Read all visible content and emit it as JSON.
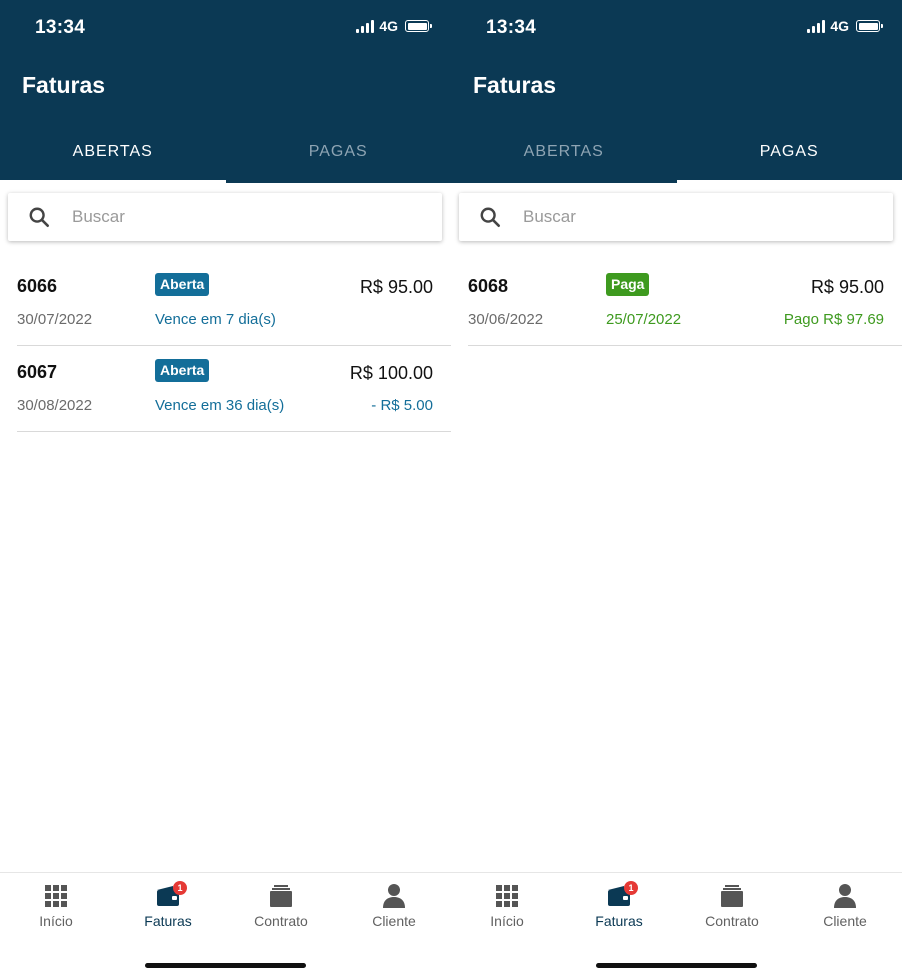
{
  "screens": [
    {
      "status": {
        "time": "13:34",
        "network": "4G"
      },
      "title": "Faturas",
      "tabs": [
        {
          "label": "ABERTAS",
          "active": true
        },
        {
          "label": "PAGAS",
          "active": false
        }
      ],
      "search": {
        "placeholder": "Buscar",
        "value": ""
      },
      "invoices": [
        {
          "number": "6066",
          "due_date": "30/07/2022",
          "status": "Aberta",
          "subtitle": "Vence em 7 dia(s)",
          "amount": "R$ 95.00",
          "extra": ""
        },
        {
          "number": "6067",
          "due_date": "30/08/2022",
          "status": "Aberta",
          "subtitle": "Vence em 36 dia(s)",
          "amount": "R$ 100.00",
          "extra": "- R$ 5.00"
        }
      ],
      "nav": [
        {
          "label": "Início",
          "icon": "grid-icon",
          "active": false
        },
        {
          "label": "Faturas",
          "icon": "wallet-icon",
          "active": true,
          "badge": "1"
        },
        {
          "label": "Contrato",
          "icon": "inbox-stack-icon",
          "active": false
        },
        {
          "label": "Cliente",
          "icon": "person-icon",
          "active": false
        }
      ]
    },
    {
      "status": {
        "time": "13:34",
        "network": "4G"
      },
      "title": "Faturas",
      "tabs": [
        {
          "label": "ABERTAS",
          "active": false
        },
        {
          "label": "PAGAS",
          "active": true
        }
      ],
      "search": {
        "placeholder": "Buscar",
        "value": ""
      },
      "invoices": [
        {
          "number": "6068",
          "due_date": "30/06/2022",
          "status": "Paga",
          "subtitle": "25/07/2022",
          "amount": "R$ 95.00",
          "extra": "Pago R$ 97.69"
        }
      ],
      "nav": [
        {
          "label": "Início",
          "icon": "grid-icon",
          "active": false
        },
        {
          "label": "Faturas",
          "icon": "wallet-icon",
          "active": true,
          "badge": "1"
        },
        {
          "label": "Contrato",
          "icon": "inbox-stack-icon",
          "active": false
        },
        {
          "label": "Cliente",
          "icon": "person-icon",
          "active": false
        }
      ]
    }
  ],
  "colors": {
    "header": "#0b3954",
    "open_accent": "#136e99",
    "paid_accent": "#3e9a1f",
    "notification": "#e53935"
  }
}
